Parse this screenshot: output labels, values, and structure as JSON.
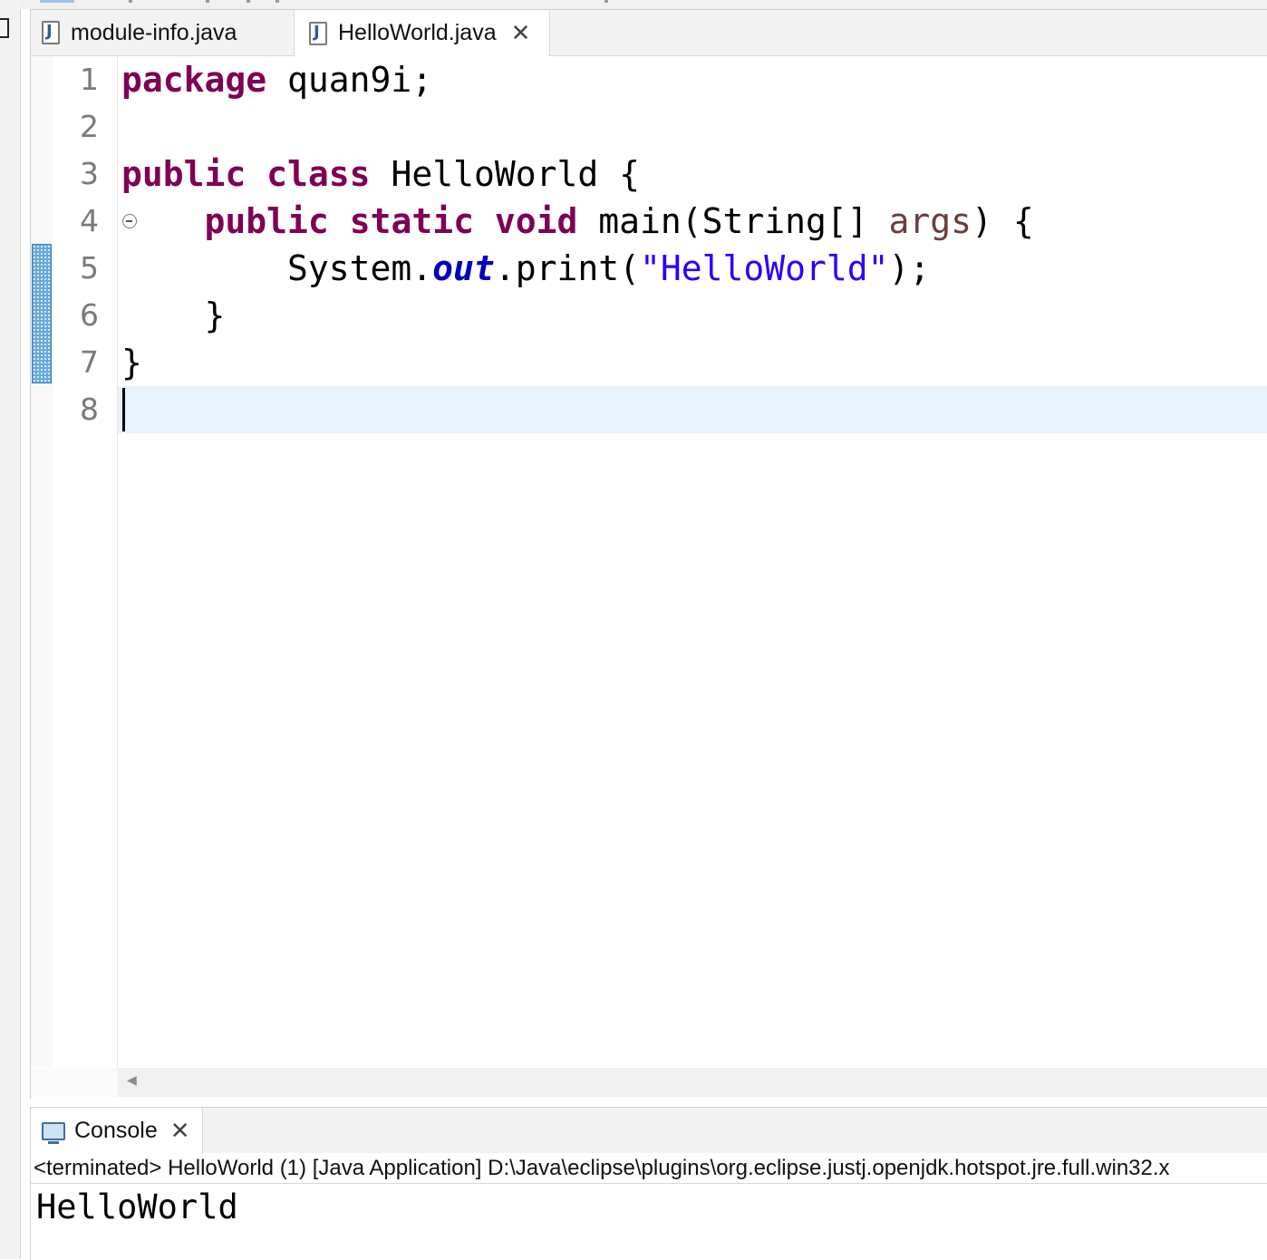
{
  "editor": {
    "tabs": [
      {
        "label": "module-info.java",
        "icon": "java-file-icon",
        "active": false
      },
      {
        "label": "HelloWorld.java",
        "icon": "java-file-icon",
        "active": true,
        "close": "✕"
      }
    ],
    "line_numbers": [
      "1",
      "2",
      "3",
      "4",
      "5",
      "6",
      "7",
      "8"
    ],
    "lines": [
      [
        {
          "t": "package",
          "c": "kw"
        },
        {
          "t": " quan9i;",
          "c": ""
        }
      ],
      [],
      [
        {
          "t": "public",
          "c": "kw"
        },
        {
          "t": " ",
          "c": ""
        },
        {
          "t": "class",
          "c": "kw"
        },
        {
          "t": " HelloWorld {",
          "c": ""
        }
      ],
      [
        {
          "t": "    ",
          "c": ""
        },
        {
          "t": "public",
          "c": "kw"
        },
        {
          "t": " ",
          "c": ""
        },
        {
          "t": "static",
          "c": "kw"
        },
        {
          "t": " ",
          "c": ""
        },
        {
          "t": "void",
          "c": "kw"
        },
        {
          "t": " main(String[] ",
          "c": ""
        },
        {
          "t": "args",
          "c": "var"
        },
        {
          "t": ") {",
          "c": ""
        }
      ],
      [
        {
          "t": "        System.",
          "c": ""
        },
        {
          "t": "out",
          "c": "fld"
        },
        {
          "t": ".print(",
          "c": ""
        },
        {
          "t": "\"HelloWorld\"",
          "c": "str"
        },
        {
          "t": ");",
          "c": ""
        }
      ],
      [
        {
          "t": "    }",
          "c": ""
        }
      ],
      [
        {
          "t": "}",
          "c": ""
        }
      ],
      []
    ],
    "current_line": 8,
    "colors": {
      "keyword": "#7f0055",
      "string": "#2a00ff",
      "field": "#0000c0",
      "variable": "#6a3e3e",
      "current_line_bg": "#e8f2fe"
    }
  },
  "console": {
    "tab_label": "Console",
    "tab_icon": "console-monitor-icon",
    "close": "✕",
    "status": "<terminated> HelloWorld (1) [Java Application] D:\\Java\\eclipse\\plugins\\org.eclipse.justj.openjdk.hotspot.jre.full.win32.x",
    "output": "HelloWorld"
  }
}
